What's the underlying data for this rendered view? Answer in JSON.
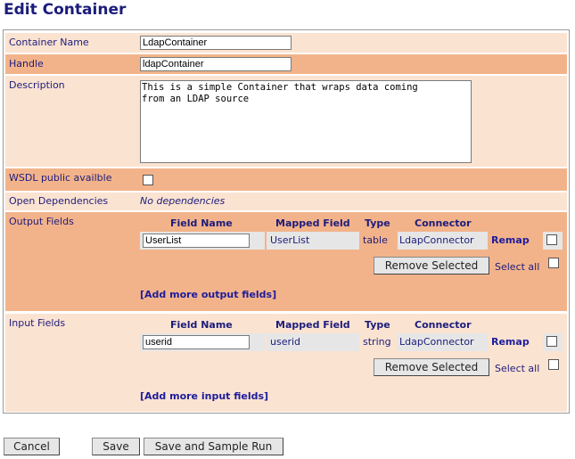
{
  "page": {
    "title": "Edit Container"
  },
  "form": {
    "container_name": {
      "label": "Container Name",
      "value": "LdapContainer"
    },
    "handle": {
      "label": "Handle",
      "value": "ldapContainer"
    },
    "description": {
      "label": "Description",
      "value": "This is a simple Container that wraps data coming\nfrom an LDAP source"
    },
    "wsdl": {
      "label": "WSDL public availble",
      "checked": false
    },
    "open_dependencies": {
      "label": "Open Dependencies",
      "value": "No dependencies"
    }
  },
  "output_fields": {
    "label": "Output Fields",
    "headers": {
      "field_name": "Field Name",
      "mapped_field": "Mapped Field",
      "type": "Type",
      "connector": "Connector"
    },
    "rows": [
      {
        "field_name": "UserList",
        "mapped_field": "UserList",
        "type": "table",
        "connector": "LdapConnector",
        "remap": "Remap"
      }
    ],
    "remove_selected": "Remove Selected",
    "select_all": "Select all",
    "add_more": "[Add more output fields]"
  },
  "input_fields": {
    "label": "Input Fields",
    "headers": {
      "field_name": "Field Name",
      "mapped_field": "Mapped Field",
      "type": "Type",
      "connector": "Connector"
    },
    "rows": [
      {
        "field_name": "userid",
        "mapped_field": "userid",
        "type": "string",
        "connector": "LdapConnector",
        "remap": "Remap"
      }
    ],
    "remove_selected": "Remove Selected",
    "select_all": "Select all",
    "add_more": "[Add more input fields]"
  },
  "actions": {
    "cancel": "Cancel",
    "save": "Save",
    "save_and_run": "Save and Sample Run"
  }
}
